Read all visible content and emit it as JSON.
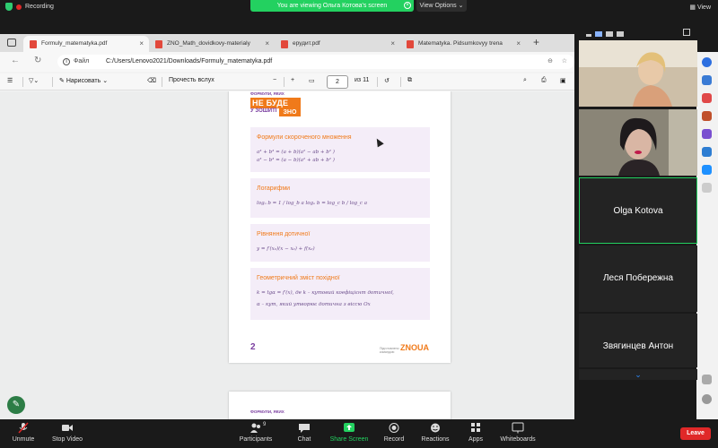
{
  "zoom_top": {
    "recording_label": "Recording",
    "viewing_banner": "You are viewing Ольга Котова's screen",
    "view_options": "View Options",
    "view_label": "View"
  },
  "browser": {
    "tabs": [
      {
        "label": "Formuly_matematyka.pdf",
        "active": true
      },
      {
        "label": "ZNO_Math_dovidkovy-materialy",
        "active": false
      },
      {
        "label": "ерудит.pdf",
        "active": false
      },
      {
        "label": "Matematyka. Pidsumkovyy trena",
        "active": false
      }
    ],
    "address": {
      "scheme_label": "Файл",
      "url": "C:/Users/Lenovo2021/Downloads/Formuly_matematyka.pdf"
    },
    "pdf_toolbar": {
      "draw_label": "Нарисовать",
      "read_aloud_label": "Прочесть вслух",
      "zoom_out": "−",
      "zoom_in": "+",
      "page_current": "2",
      "page_total_label": "из 11"
    }
  },
  "pdf_page": {
    "header_small": "ФОРМУЛИ, ЯКИХ",
    "logo_line": "НЕ БУДЕ",
    "logo_sub": "У ЗОШИТІ",
    "logo_zno": "ЗНО",
    "blocks": [
      {
        "title": "Формули скороченого множення",
        "formulas": [
          "a³ + b³ = (a + b)(a² − ab + b² )",
          "a³ − b³ = (a − b)(a² + ab + b² )"
        ]
      },
      {
        "title": "Логарифми",
        "formulas": [
          "logₐ b = 1 / log_b a        logₐ b = log_c b / log_c a"
        ]
      },
      {
        "title": "Рівняння дотичної",
        "formulas": [
          "y = f′(x₀)(x − x₀) + f(x₀)"
        ]
      },
      {
        "title": "Геометричний зміст похідної",
        "formulas": [
          "k = tgα = f′(x), де  k – кутовий коефіцієнт дотичної,",
          "α – кут, який утворює дотична з віссю  Ox"
        ]
      }
    ],
    "page_number": "2",
    "footer_small": "Підготовлено командою",
    "footer_logo": "ZNOUA",
    "next_page_header": "ФОРМУЛИ, ЯКИХ"
  },
  "participants": [
    {
      "name": "Olga Kotova",
      "type": "name",
      "speaking": true
    },
    {
      "name": "Леся Побережна",
      "type": "name",
      "speaking": false
    },
    {
      "name": "Звягинцев Антон",
      "type": "name",
      "speaking": false
    }
  ],
  "zoom_bottom": {
    "unmute": "Unmute",
    "stop_video": "Stop Video",
    "participants": "Participants",
    "participants_count": "9",
    "chat": "Chat",
    "share_screen": "Share Screen",
    "record": "Record",
    "reactions": "Reactions",
    "apps": "Apps",
    "whiteboards": "Whiteboards",
    "leave": "Leave"
  },
  "colors": {
    "zoom_green": "#23d160",
    "pdf_orange": "#f07a1a",
    "pdf_purple": "#7b3fa0",
    "leave_red": "#e02828"
  }
}
